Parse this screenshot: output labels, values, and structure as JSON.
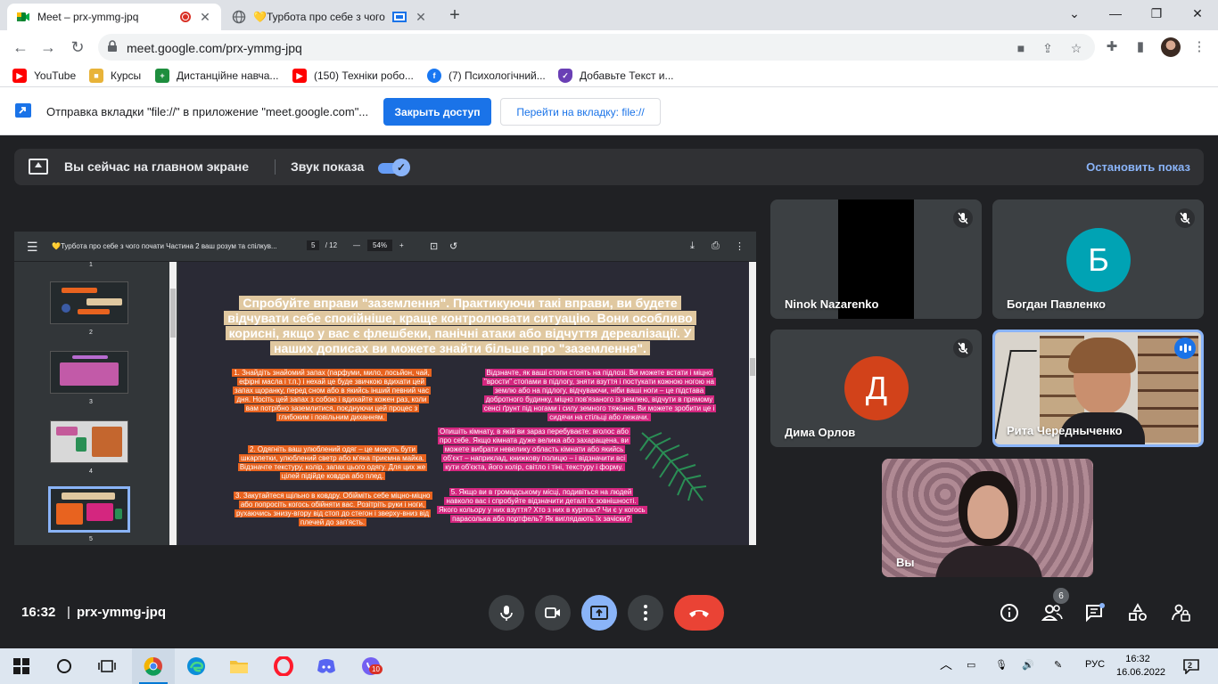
{
  "browser": {
    "tabs": [
      {
        "title": "Meet – prx-ymmg-jpq",
        "active": true,
        "recording": true
      },
      {
        "title": "💛Турбота про себе з чого",
        "active": false
      }
    ],
    "url": "meet.google.com/prx-ymmg-jpq",
    "bookmarks": [
      {
        "label": "YouTube",
        "icon": "youtube-icon",
        "color": "#ff0000"
      },
      {
        "label": "Курсы",
        "icon": "folder-icon",
        "color": "#e8b339"
      },
      {
        "label": "Дистанційне навча...",
        "icon": "classroom-icon",
        "color": "#1e8e3e"
      },
      {
        "label": "(150) Техніки робо...",
        "icon": "youtube-icon",
        "color": "#ff0000"
      },
      {
        "label": "(7) Психологічний...",
        "icon": "facebook-icon",
        "color": "#1877f2"
      },
      {
        "label": "Добавьте Текст и...",
        "icon": "shield-icon",
        "color": "#6a3fb5"
      }
    ]
  },
  "infobar": {
    "message": "Отправка вкладки \"file://\" в приложение \"meet.google.com\"...",
    "share_button": "Закрыть доступ",
    "goto_button": "Перейти на вкладку: file://"
  },
  "presenting_banner": {
    "text": "Вы сейчас на главном экране",
    "sound_label": "Звук показа",
    "sound_on": true,
    "stop_label": "Остановить показ"
  },
  "pdf_viewer": {
    "title": "💛Турбота про себе з чого почати Частина 2 ваш розум та спілкув...",
    "current_page": "5",
    "total_pages": "/ 12",
    "zoom": "54%",
    "thumbnails": [
      "1",
      "2",
      "3",
      "4",
      "5"
    ],
    "slide": {
      "title": "Спробуйте вправи \"заземлення\". Практикуючи такі вправи, ви будете відчувати себе спокійніше, краще контролювати ситуацію. Вони особливо корисні, якщо у вас є флешбеки, панічні атаки або відчуття дереалізації. У наших дописах ви можете знайти більше про \"заземлення\".",
      "left_boxes": [
        "1. Знайдіть знайомий запах (парфуми, мило, лосьйон, чай, ефірні масла і т.п.) і нехай це буде звичкою вдихати цей запах щоранку, перед сном або в якийсь інший певний час дня. Носіть цей запах з собою і вдихайте кожен раз, коли вам потрібно заземлитися, поєднуючи цей процес з глибоким і повільним диханням.",
        "2. Одягніть ваш улюблений одяг – це можуть бути шкарпетки, улюблений светр або м'яка приємна майка. Відзначте текстуру, колір, запах цього одягу. Для цих же цілей підійде ковдра або плед.",
        "3. Закутайтеся щільно в ковдру. Обійміть себе міцно-міцно або попросіть когось обійняти вас. Розітріть руки і ноги, рухаючись знизу-вгору від стоп до стегон і зверху-вниз від плечей до зап'ясть."
      ],
      "right_boxes": [
        "Відзначте, як ваші стопи стоять на підлозі. Ви можете встати і міцно \"врости\" стопами в підлогу, зняти взуття і постукати кожною ногою на землю або на підлогу, відчуваючи, ніби ваші ноги – це підстава добротного будинку, міцно пов'язаного із землею, відчути в прямому сенсі ґрунт під ногами і силу земного тяжіння. Ви можете зробити це і сидячи на стільці або лежачи.",
        "Опишіть кімнату, в якій ви зараз перебуваєте: вголос або про себе. Якщо кімната дуже велика або захаращена, ви можете вибрати невелику область кімнати або якийсь об'єкт – наприклад, книжкову полицю – і відзначити всі кути об'єкта, його колір, світло і тіні, текстуру і форму.",
        "5. Якщо ви в громадському місці, подивіться на людей навколо вас і спробуйте відзначити деталі їх зовнішності. Якого кольору у них взуття? Хто з них в куртках? Чи є у когось парасолька або портфель? Як виглядають їх зачіски?"
      ]
    }
  },
  "participants": [
    {
      "name": "Ninok Nazarenko",
      "muted": true,
      "type": "video-dark"
    },
    {
      "name": "Богдан Павленко",
      "muted": true,
      "type": "avatar",
      "initial": "Б",
      "color": "#00a3b4"
    },
    {
      "name": "Дима Орлов",
      "muted": true,
      "type": "avatar",
      "initial": "Д",
      "color": "#d2421a"
    },
    {
      "name": "Рита Чередныченко",
      "muted": false,
      "speaking": true,
      "type": "video"
    },
    {
      "name": "Вы",
      "muted": false,
      "type": "video-self"
    }
  ],
  "controls": {
    "time": "16:32",
    "separator": "|",
    "meeting_code": "prx-ymmg-jpq",
    "participants_count": "6"
  },
  "taskbar": {
    "language": "РУС",
    "time": "16:32",
    "date": "16.06.2022",
    "notifications": "2",
    "viber_badge": "10"
  },
  "colors": {
    "meet_bg": "#202124",
    "accent_blue": "#1a73e8",
    "hangup_red": "#ea4335",
    "present_blue": "#8ab4f8"
  }
}
